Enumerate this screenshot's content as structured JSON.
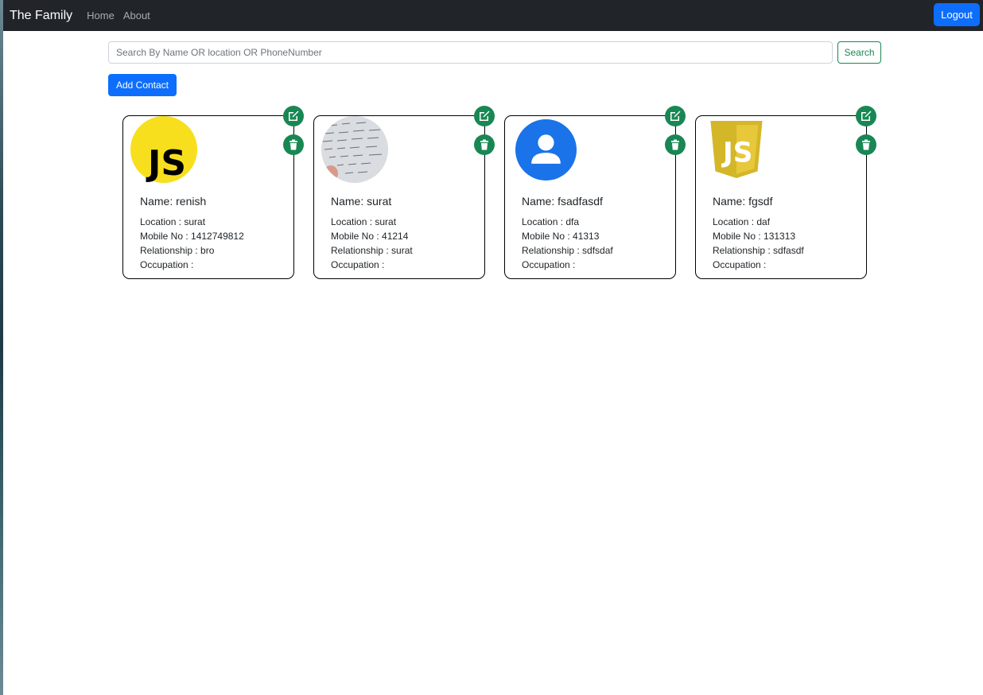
{
  "navbar": {
    "brand": "The Family",
    "links": [
      "Home",
      "About"
    ],
    "logout_label": "Logout"
  },
  "search": {
    "placeholder": "Search By Name OR location OR PhoneNumber",
    "value": "",
    "button_label": "Search"
  },
  "add_contact_label": "Add Contact",
  "colors": {
    "navbar": "#212529",
    "primary": "#0d6efd",
    "success": "#198754"
  },
  "contacts": [
    {
      "avatar": "javascript-circle-logo",
      "name": "Name: renish",
      "location": "Location : surat",
      "mobile": "Mobile No : 1412749812",
      "relationship": "Relationship : bro",
      "occupation": "Occupation :"
    },
    {
      "avatar": "photo-avatar",
      "name": "Name: surat",
      "location": "Location : surat",
      "mobile": "Mobile No : 41214",
      "relationship": "Relationship : surat",
      "occupation": "Occupation :"
    },
    {
      "avatar": "default-person-avatar",
      "name": "Name: fsadfasdf",
      "location": "Location : dfa",
      "mobile": "Mobile No : 41313",
      "relationship": "Relationship : sdfsdaf",
      "occupation": "Occupation :"
    },
    {
      "avatar": "javascript-shield-logo",
      "name": "Name: fgsdf",
      "location": "Location : daf",
      "mobile": "Mobile No : 131313",
      "relationship": "Relationship : sdfasdf",
      "occupation": "Occupation :"
    }
  ]
}
